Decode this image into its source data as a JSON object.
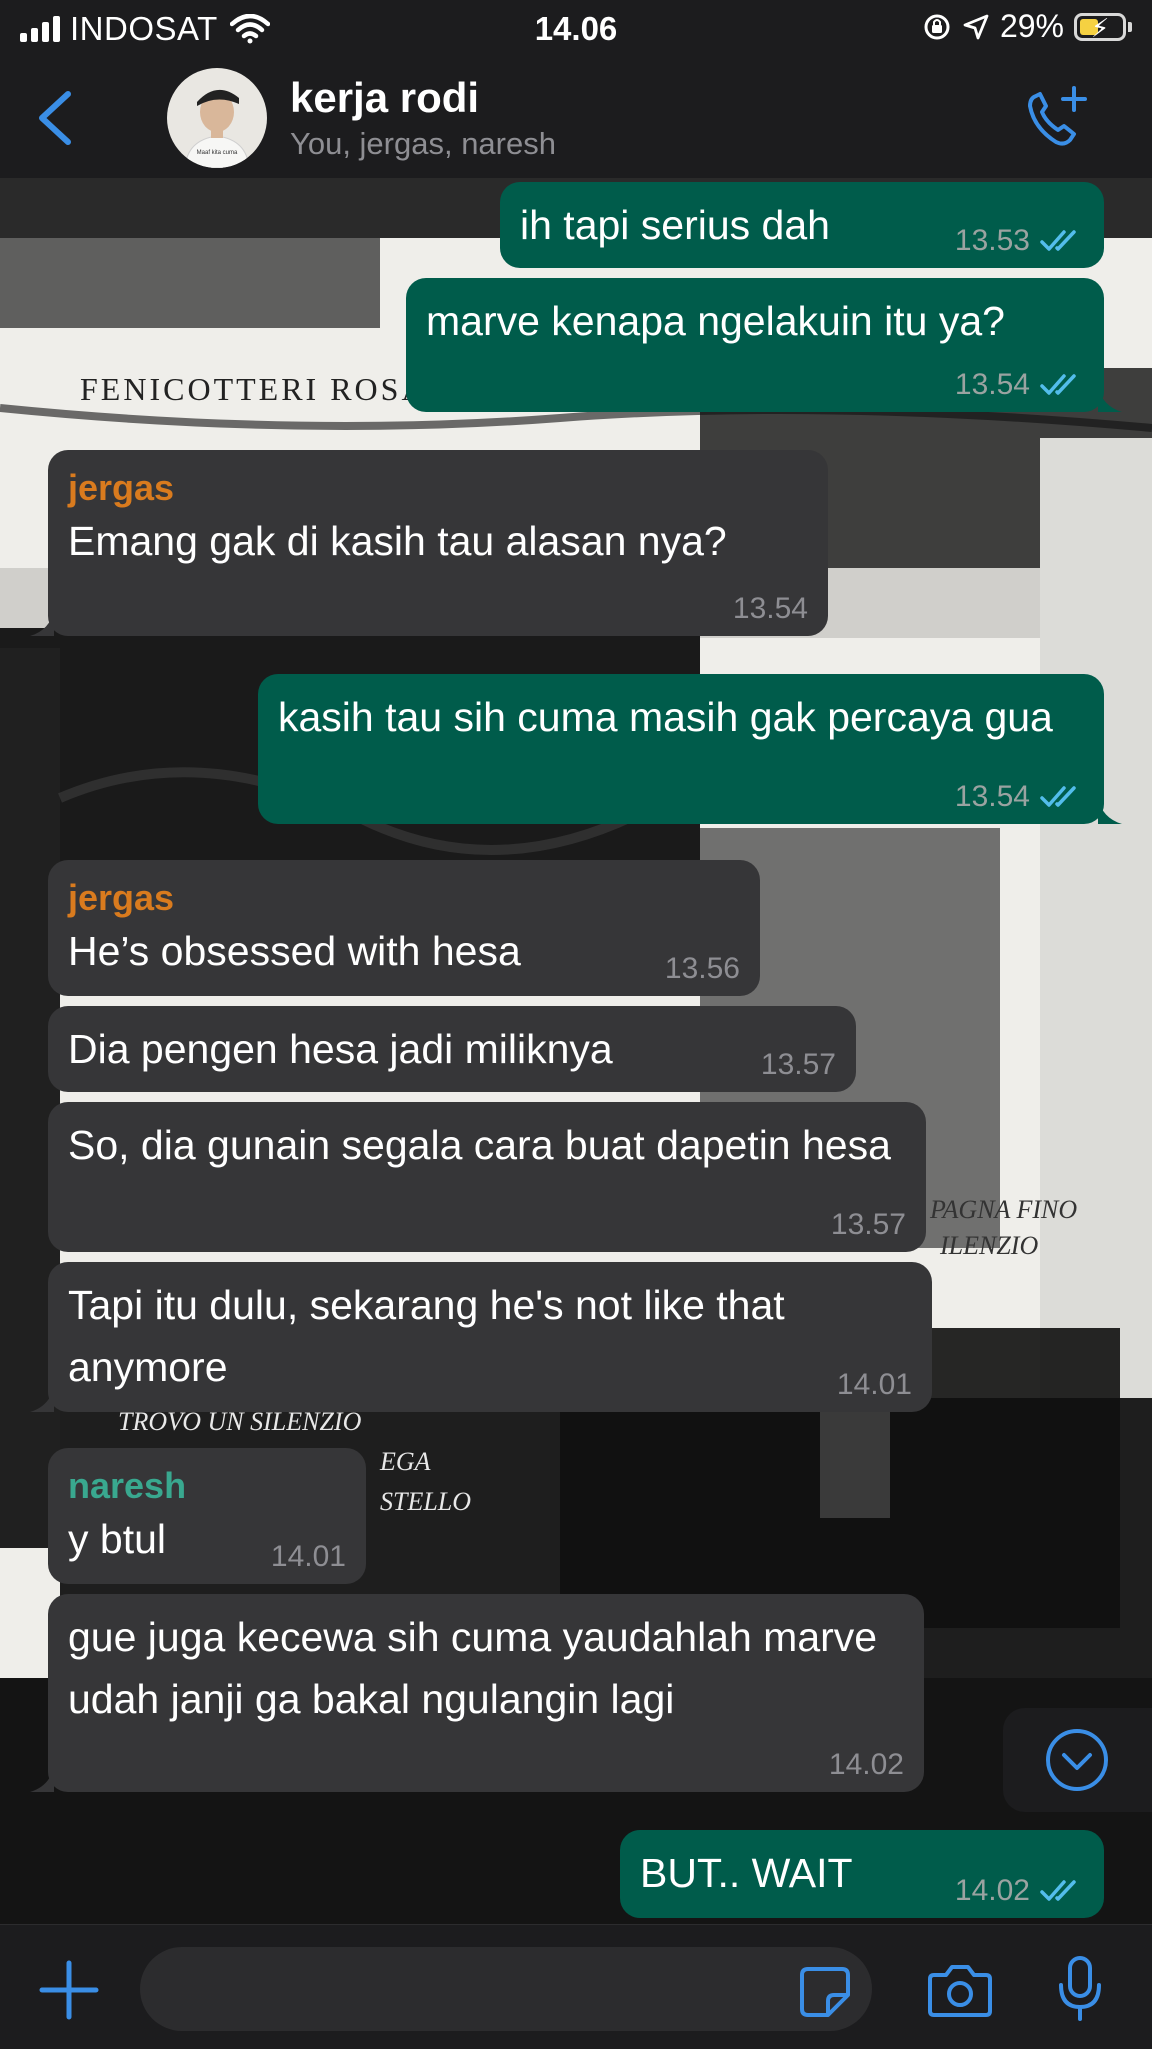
{
  "status_bar": {
    "carrier": "INDOSAT",
    "time": "14.06",
    "battery": "29%"
  },
  "header": {
    "title": "kerja rodi",
    "members": "You, jergas, naresh",
    "avatar_caption": "Maaf kita cuma"
  },
  "messages": [
    {
      "direction": "out",
      "text": "ih tapi serius dah",
      "time": "13.53"
    },
    {
      "direction": "out",
      "text": "marve kenapa ngelakuin itu ya?",
      "time": "13.54"
    },
    {
      "direction": "in",
      "sender": "jergas",
      "text": "Emang gak di kasih tau alasan nya?",
      "time": "13.54"
    },
    {
      "direction": "out",
      "text": "kasih tau sih cuma masih gak percaya gua",
      "time": "13.54"
    },
    {
      "direction": "in",
      "sender": "jergas",
      "text": "He’s obsessed with hesa",
      "time": "13.56"
    },
    {
      "direction": "in",
      "text": "Dia pengen hesa jadi miliknya",
      "time": "13.57"
    },
    {
      "direction": "in",
      "text": "So, dia gunain segala cara buat dapetin hesa",
      "time": "13.57"
    },
    {
      "direction": "in",
      "text": "Tapi itu dulu, sekarang he's not like that anymore",
      "time": "14.01"
    },
    {
      "direction": "in",
      "sender": "naresh",
      "text": "y btul",
      "time": "14.01"
    },
    {
      "direction": "in",
      "text": "gue juga kecewa sih cuma yaudahlah marve udah janji ga bakal ngulangin lagi",
      "time": "14.02"
    },
    {
      "direction": "out",
      "text": "BUT.. WAIT",
      "time": "14.02"
    }
  ],
  "wallpaper_text": {
    "line1": "FENICOTTERI ROSA",
    "line2": "PAGNA FINO",
    "line3": "ILENZIO",
    "line4": "TROVO UN SILENZIO",
    "line5": "EGA",
    "line6": "STELLO"
  },
  "colors": {
    "outgoing_bubble": "#005c4b",
    "incoming_bubble": "#363638",
    "bar_background": "#1c1c1e",
    "accent": "#3a8ee6",
    "sender_jergas": "#d97b1e",
    "sender_naresh": "#39a88f",
    "read_ticks": "#53bdeb"
  },
  "icons": [
    "back-icon",
    "call-add-icon",
    "scroll-down-icon",
    "add-icon",
    "sticker-icon",
    "camera-icon",
    "mic-icon",
    "read-ticks-icon"
  ],
  "input": {
    "placeholder": ""
  }
}
